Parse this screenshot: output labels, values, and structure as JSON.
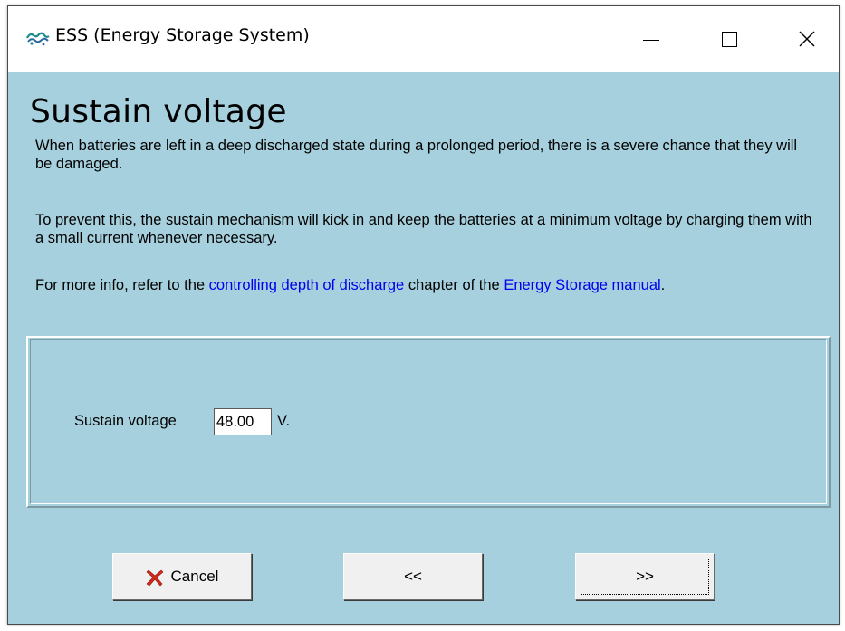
{
  "window": {
    "title": "ESS (Energy Storage System)",
    "icon": "app-logo-icon",
    "controls": {
      "minimize": "minimize-icon",
      "maximize": "maximize-icon",
      "close_glyph": "✕"
    }
  },
  "page": {
    "heading": "Sustain voltage",
    "paragraph1": "When batteries are left in a deep discharged state during a prolonged period, there is a severe chance that they will be damaged.",
    "paragraph2": "To prevent this, the sustain mechanism will kick in and keep the batteries at a minimum voltage by charging them with a small current whenever necessary.",
    "paragraph3_prefix": "For more info, refer to the ",
    "link1": "controlling depth of discharge",
    "paragraph3_middle": " chapter of the ",
    "link2": "Energy Storage manual",
    "paragraph3_suffix": ".",
    "link_color": "#0000ee"
  },
  "form": {
    "sustain_voltage_label": "Sustain voltage",
    "sustain_voltage_value": "48.00",
    "sustain_voltage_unit": "V."
  },
  "buttons": {
    "cancel_label": "Cancel",
    "cancel_icon": "red-x-icon",
    "back_label": "<<",
    "next_label": ">>"
  },
  "colors": {
    "background": "#a6d0dd",
    "titlebar": "#ffffff",
    "button_face": "#f0f0f0",
    "cancel_icon": "#d42a1a"
  }
}
